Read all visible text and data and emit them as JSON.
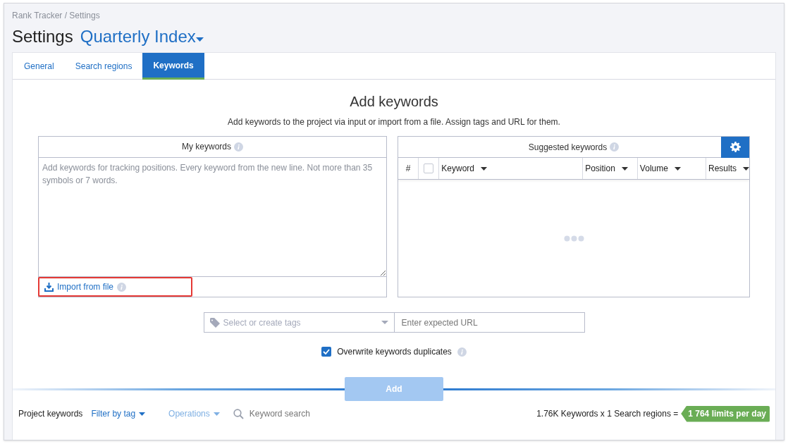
{
  "breadcrumb": "Rank Tracker / Settings",
  "title": "Settings",
  "project": "Quarterly Index",
  "tabs": [
    {
      "label": "General",
      "selected": false
    },
    {
      "label": "Search regions",
      "selected": false
    },
    {
      "label": "Keywords",
      "selected": true
    }
  ],
  "heading": "Add keywords",
  "subtitle": "Add keywords to the project via input or import from a file. Assign tags and URL for them.",
  "my_keywords": {
    "title": "My keywords",
    "placeholder": "Add keywords for tracking positions. Every keyword from the new line. Not more than 35 symbols or 7 words.",
    "import_link": "Import from file",
    "import_highlighted": true
  },
  "suggested": {
    "title": "Suggested keywords",
    "columns": [
      "#",
      "Keyword",
      "Position",
      "Volume",
      "Results"
    ],
    "select_all_checked": false,
    "loading": true
  },
  "tags_field": {
    "placeholder": "Select or create tags"
  },
  "url_field": {
    "placeholder": "Enter expected URL"
  },
  "overwrite": {
    "label": "Overwrite keywords duplicates",
    "checked": true
  },
  "add_button": {
    "label": "Add",
    "disabled": true
  },
  "bottom_bar": {
    "label": "Project keywords",
    "filter": "Filter by tag",
    "operations": "Operations",
    "operations_disabled": true,
    "search_placeholder": "Keyword search",
    "summary": "1.76K Keywords x 1 Search regions =",
    "limit_badge": "1 764 limits per day"
  }
}
